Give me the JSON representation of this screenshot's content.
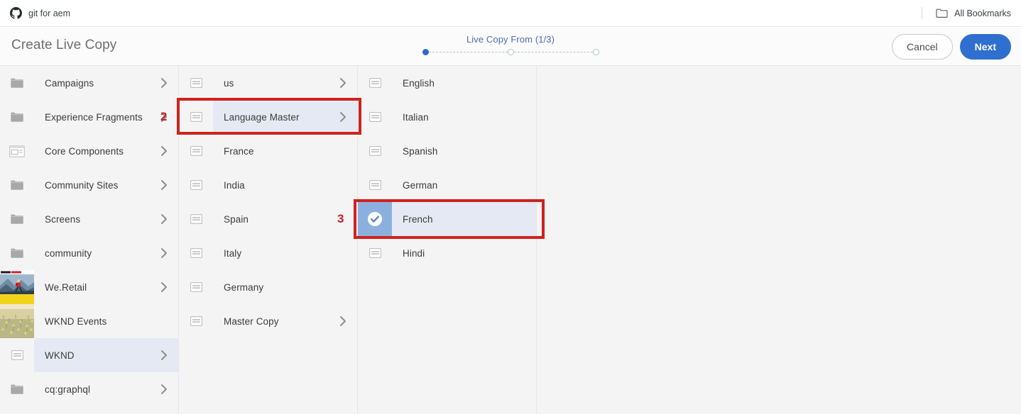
{
  "browser": {
    "tab_label": "git for aem",
    "github_icon": "github-icon",
    "bookmarks_label": "All Bookmarks",
    "bookmarks_icon": "folder-icon"
  },
  "header": {
    "title": "Create Live Copy",
    "wizard_label": "Live Copy From (1/3)",
    "steps_total": 3,
    "step_current": 1,
    "cancel_label": "Cancel",
    "next_label": "Next",
    "accent_color": "#2f6fd0",
    "wizard_label_color": "#4b6cb0"
  },
  "columns": [
    {
      "name": "column-1",
      "items": [
        {
          "label": "Campaigns",
          "icon": "folder-icon",
          "chevron": true,
          "state": "none"
        },
        {
          "label": "Experience Fragments",
          "icon": "folder-icon",
          "chevron": true,
          "state": "none"
        },
        {
          "label": "Core Components",
          "icon": "component-icon",
          "chevron": true,
          "state": "none"
        },
        {
          "label": "Community Sites",
          "icon": "folder-icon",
          "chevron": true,
          "state": "none"
        },
        {
          "label": "Screens",
          "icon": "folder-icon",
          "chevron": true,
          "state": "none"
        },
        {
          "label": "community",
          "icon": "folder-icon",
          "chevron": true,
          "state": "none"
        },
        {
          "label": "We.Retail",
          "icon": "thumbnail-hiker",
          "chevron": true,
          "state": "none"
        },
        {
          "label": "WKND Events",
          "icon": "thumbnail-field",
          "chevron": false,
          "state": "none"
        },
        {
          "label": "WKND",
          "icon": "page-icon",
          "chevron": true,
          "state": "selected"
        },
        {
          "label": "cq:graphql",
          "icon": "folder-icon",
          "chevron": true,
          "state": "none"
        }
      ]
    },
    {
      "name": "column-2",
      "items": [
        {
          "label": "us",
          "icon": "page-icon",
          "chevron": true,
          "state": "none"
        },
        {
          "label": "Language Master",
          "icon": "page-icon",
          "chevron": true,
          "state": "selected"
        },
        {
          "label": "France",
          "icon": "page-icon",
          "chevron": false,
          "state": "none"
        },
        {
          "label": "India",
          "icon": "page-icon",
          "chevron": false,
          "state": "none"
        },
        {
          "label": "Spain",
          "icon": "page-icon",
          "chevron": false,
          "state": "none"
        },
        {
          "label": "Italy",
          "icon": "page-icon",
          "chevron": false,
          "state": "none"
        },
        {
          "label": "Germany",
          "icon": "page-icon",
          "chevron": false,
          "state": "none"
        },
        {
          "label": "Master Copy",
          "icon": "page-icon",
          "chevron": true,
          "state": "none"
        }
      ]
    },
    {
      "name": "column-3",
      "items": [
        {
          "label": "English",
          "icon": "page-icon",
          "chevron": false,
          "state": "none"
        },
        {
          "label": "Italian",
          "icon": "page-icon",
          "chevron": false,
          "state": "none"
        },
        {
          "label": "Spanish",
          "icon": "page-icon",
          "chevron": false,
          "state": "none"
        },
        {
          "label": "German",
          "icon": "page-icon",
          "chevron": false,
          "state": "none"
        },
        {
          "label": "French",
          "icon": "check-icon",
          "chevron": false,
          "state": "checked"
        },
        {
          "label": "Hindi",
          "icon": "page-icon",
          "chevron": false,
          "state": "none"
        }
      ]
    }
  ],
  "annotations": [
    {
      "number": "2",
      "label": "annotation-2-language-master"
    },
    {
      "number": "3",
      "label": "annotation-3-french"
    }
  ],
  "colors": {
    "annotation_red": "#d0211c",
    "selected_row": "#e5e9f3",
    "checked_icon_bg": "#8cb0de",
    "column_bg": "#f4f4f4"
  }
}
